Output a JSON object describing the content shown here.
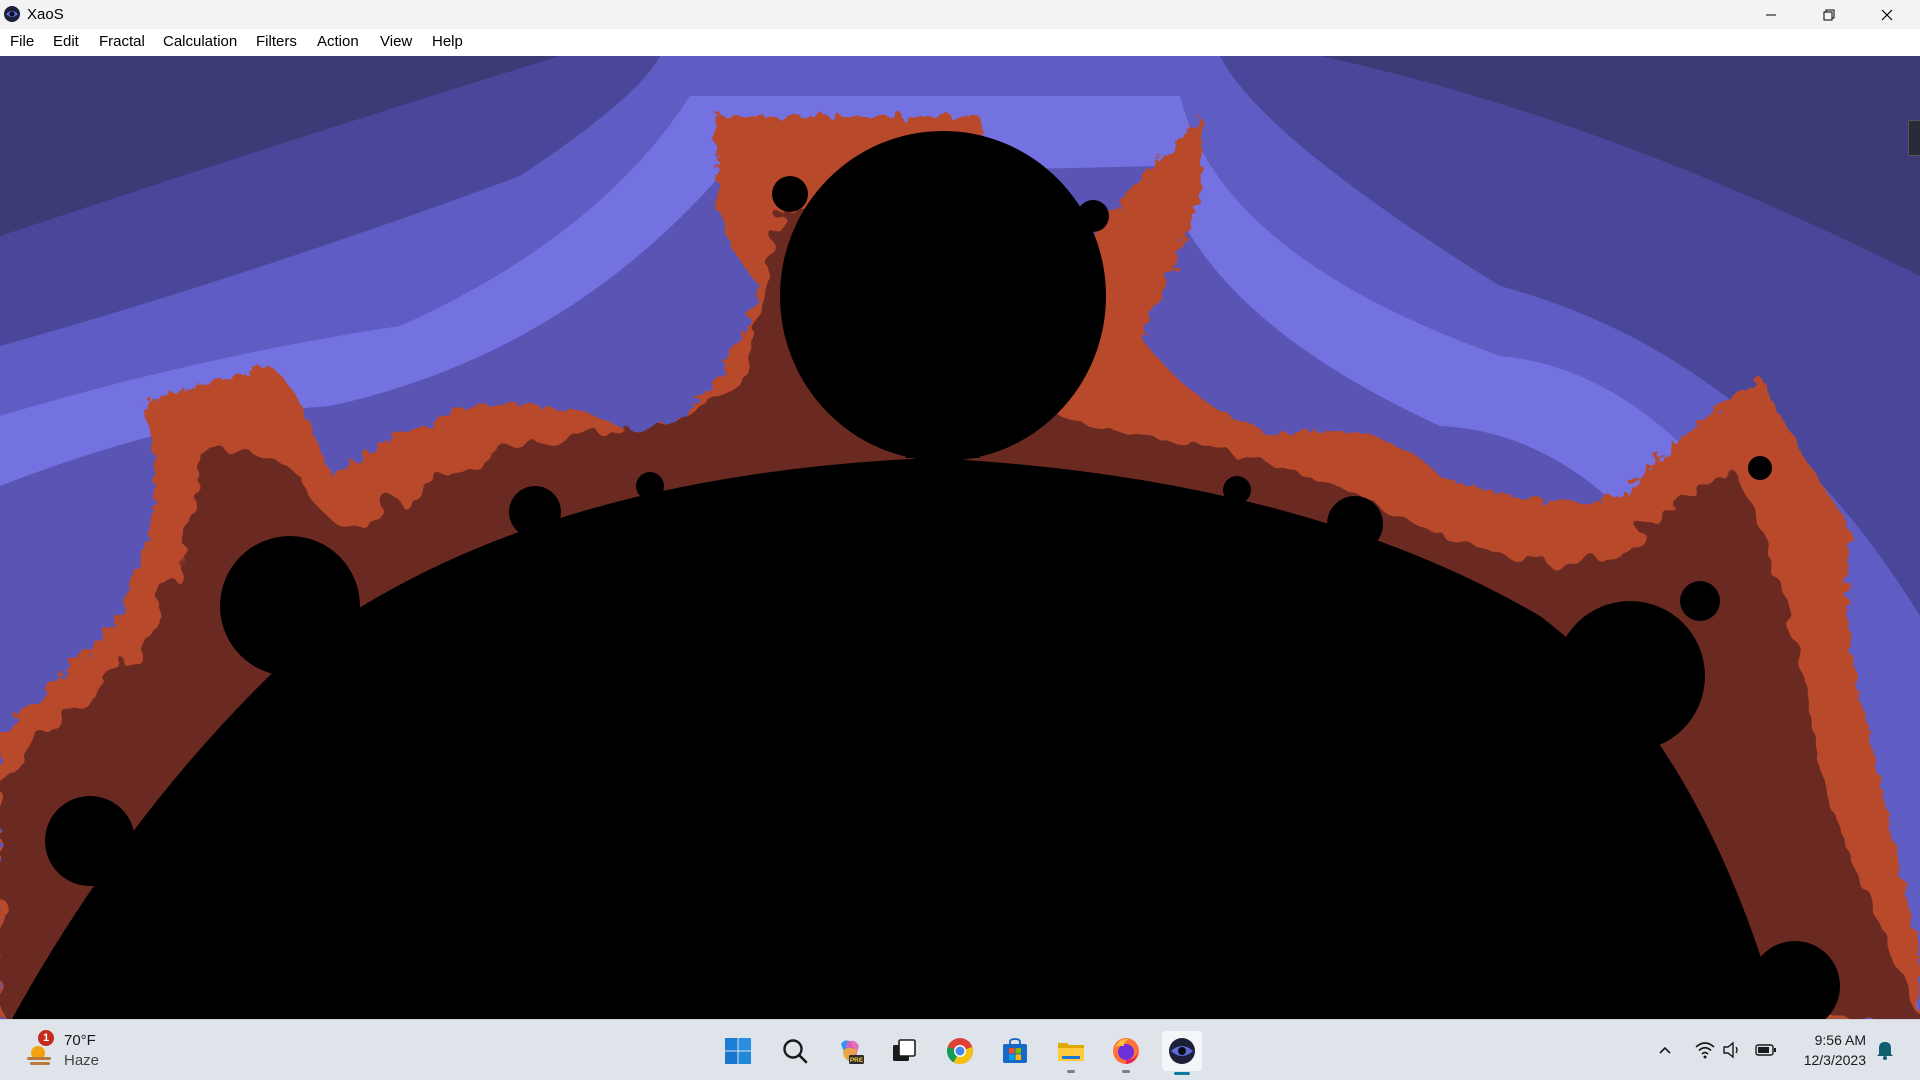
{
  "window": {
    "title": "XaoS",
    "controls": {
      "minimize": "minimize-icon",
      "restore": "restore-icon",
      "close": "close-icon"
    }
  },
  "menubar": {
    "items": [
      {
        "label": "File"
      },
      {
        "label": "Edit"
      },
      {
        "label": "Fractal"
      },
      {
        "label": "Calculation"
      },
      {
        "label": "Filters"
      },
      {
        "label": "Action"
      },
      {
        "label": "View"
      },
      {
        "label": "Help"
      }
    ]
  },
  "fractal": {
    "type": "Mandelbrot zoom",
    "colors": {
      "set": "#000000",
      "outer_dark": "#3a3670",
      "mid_band": "#5a58b8",
      "light_band": "#7b7ae8",
      "edge": "#c4552a",
      "edge_dark": "#5a1f1a"
    }
  },
  "taskbar": {
    "weather": {
      "temp": "70°F",
      "condition": "Haze",
      "badge": "1",
      "icon": "weather-sun-haze-icon"
    },
    "apps": [
      {
        "name": "start-button",
        "icon": "windows-logo-icon"
      },
      {
        "name": "search-button",
        "icon": "search-icon"
      },
      {
        "name": "copilot-button",
        "icon": "copilot-icon",
        "badge": "PRE"
      },
      {
        "name": "task-view-button",
        "icon": "task-view-icon"
      },
      {
        "name": "chrome-button",
        "icon": "chrome-icon"
      },
      {
        "name": "store-button",
        "icon": "store-icon"
      },
      {
        "name": "file-explorer-button",
        "icon": "folder-icon"
      },
      {
        "name": "firefox-button",
        "icon": "firefox-icon"
      },
      {
        "name": "xaos-button",
        "icon": "xaos-icon"
      }
    ],
    "tray": {
      "chevron": "chevron-up-icon",
      "wifi": "wifi-icon",
      "volume": "volume-icon",
      "battery": "battery-icon",
      "time": "9:56 AM",
      "date": "12/3/2023",
      "notifications": "bell-icon"
    }
  }
}
